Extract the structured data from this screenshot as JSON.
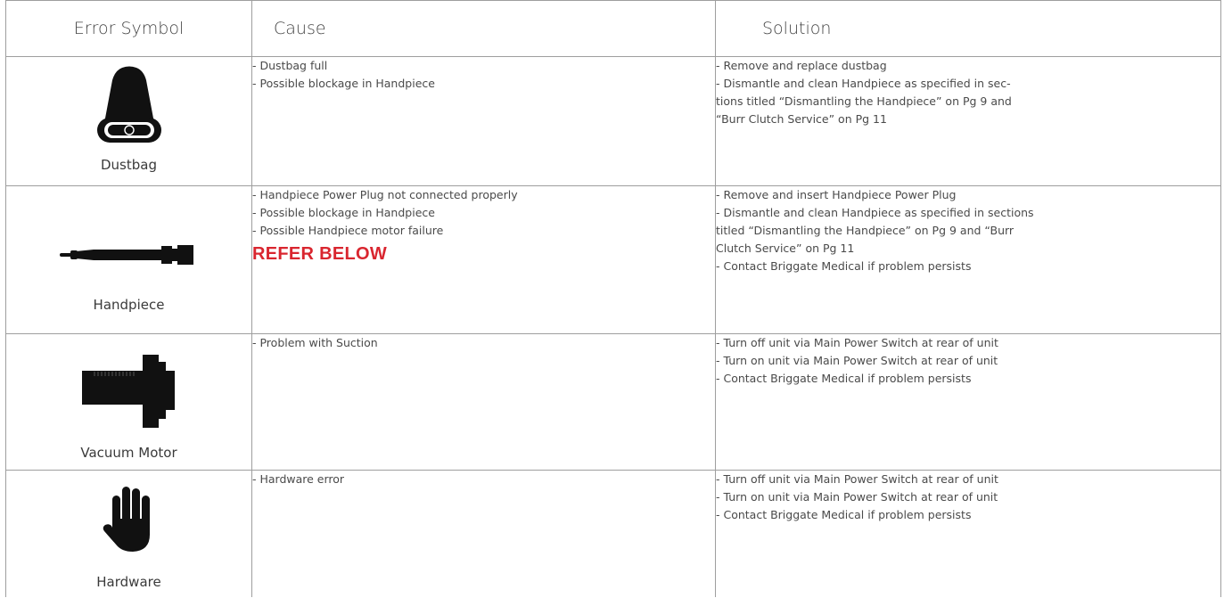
{
  "headers": {
    "symbol": "Error Symbol",
    "cause": "Cause",
    "solution": "Solution"
  },
  "rows": [
    {
      "symbol_label": "Dustbag",
      "icon": "dustbag-icon",
      "cause": [
        "- Dustbag full",
        "- Possible blockage in Handpiece"
      ],
      "note": "",
      "solution": [
        "- Remove and replace dustbag",
        "- Dismantle and clean Handpiece as specified in sec-",
        "tions titled “Dismantling the Handpiece” on Pg 9 and",
        "“Burr Clutch Service” on Pg 11"
      ]
    },
    {
      "symbol_label": "Handpiece",
      "icon": "handpiece-icon",
      "cause": [
        "- Handpiece Power Plug not connected properly",
        "- Possible blockage in Handpiece",
        "- Possible Handpiece motor failure"
      ],
      "note": "REFER BELOW",
      "solution": [
        "- Remove and insert Handpiece Power Plug",
        "- Dismantle and clean Handpiece as specified in sections",
        "titled “Dismantling the Handpiece” on Pg 9 and “Burr",
        "Clutch Service” on Pg 11",
        "- Contact Briggate Medical if problem persists"
      ]
    },
    {
      "symbol_label": "Vacuum Motor",
      "icon": "vacuum-motor-icon",
      "cause": [
        "- Problem with Suction"
      ],
      "note": "",
      "solution": [
        "- Turn off unit via Main Power Switch at rear of unit",
        "- Turn on unit via Main Power Switch at rear of unit",
        "- Contact Briggate Medical if problem persists"
      ]
    },
    {
      "symbol_label": "Hardware",
      "icon": "hand-stop-icon",
      "cause": [
        "- Hardware error"
      ],
      "note": "",
      "solution": [
        "- Turn off unit via Main Power Switch at rear of unit",
        "- Turn on unit via Main Power Switch at rear of unit",
        "- Contact Briggate Medical if problem persists"
      ]
    }
  ],
  "colors": {
    "text": "#3a3a3a",
    "border": "#9e9e9e",
    "alert": "#d9262f",
    "icon": "#111111"
  }
}
